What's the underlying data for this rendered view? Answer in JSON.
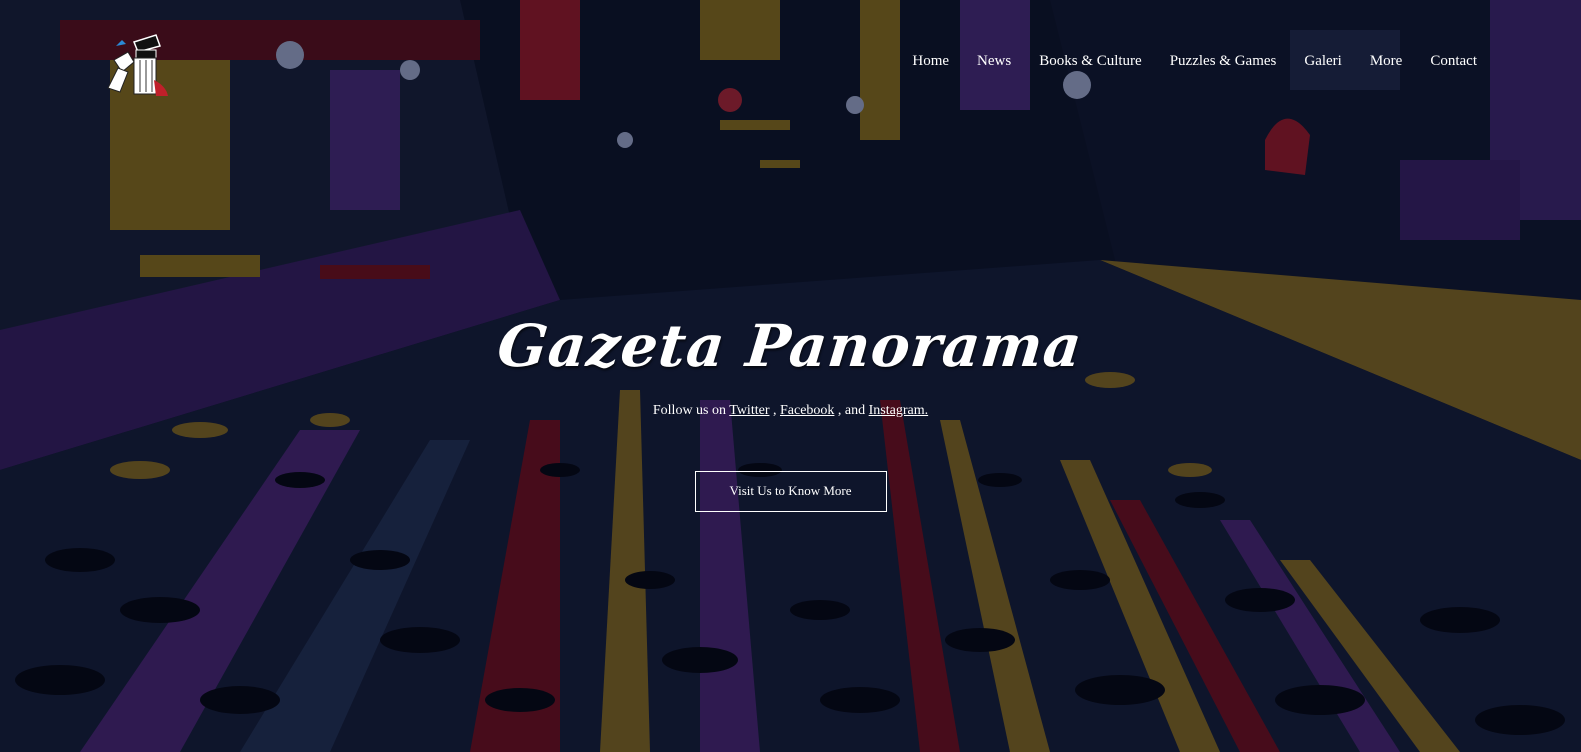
{
  "site": {
    "title": "Gazeta Panorama"
  },
  "nav": {
    "items": [
      {
        "label": "Home"
      },
      {
        "label": "News"
      },
      {
        "label": "Books & Culture"
      },
      {
        "label": "Puzzles & Games"
      },
      {
        "label": "Galeri"
      },
      {
        "label": "More"
      },
      {
        "label": "Contact"
      }
    ]
  },
  "hero": {
    "follow_prefix": "Follow us on ",
    "twitter_label": "Twitter",
    "sep1": " , ",
    "facebook_label": "Facebook",
    "sep2": " , and ",
    "instagram_label": "Instagram.",
    "cta_label": "Visit Us to Know More"
  },
  "colors": {
    "background": "#070a1a",
    "text": "#ffffff",
    "accent_yellow": "#7a6520",
    "accent_purple": "#3c2062",
    "accent_red": "#6e1020"
  }
}
